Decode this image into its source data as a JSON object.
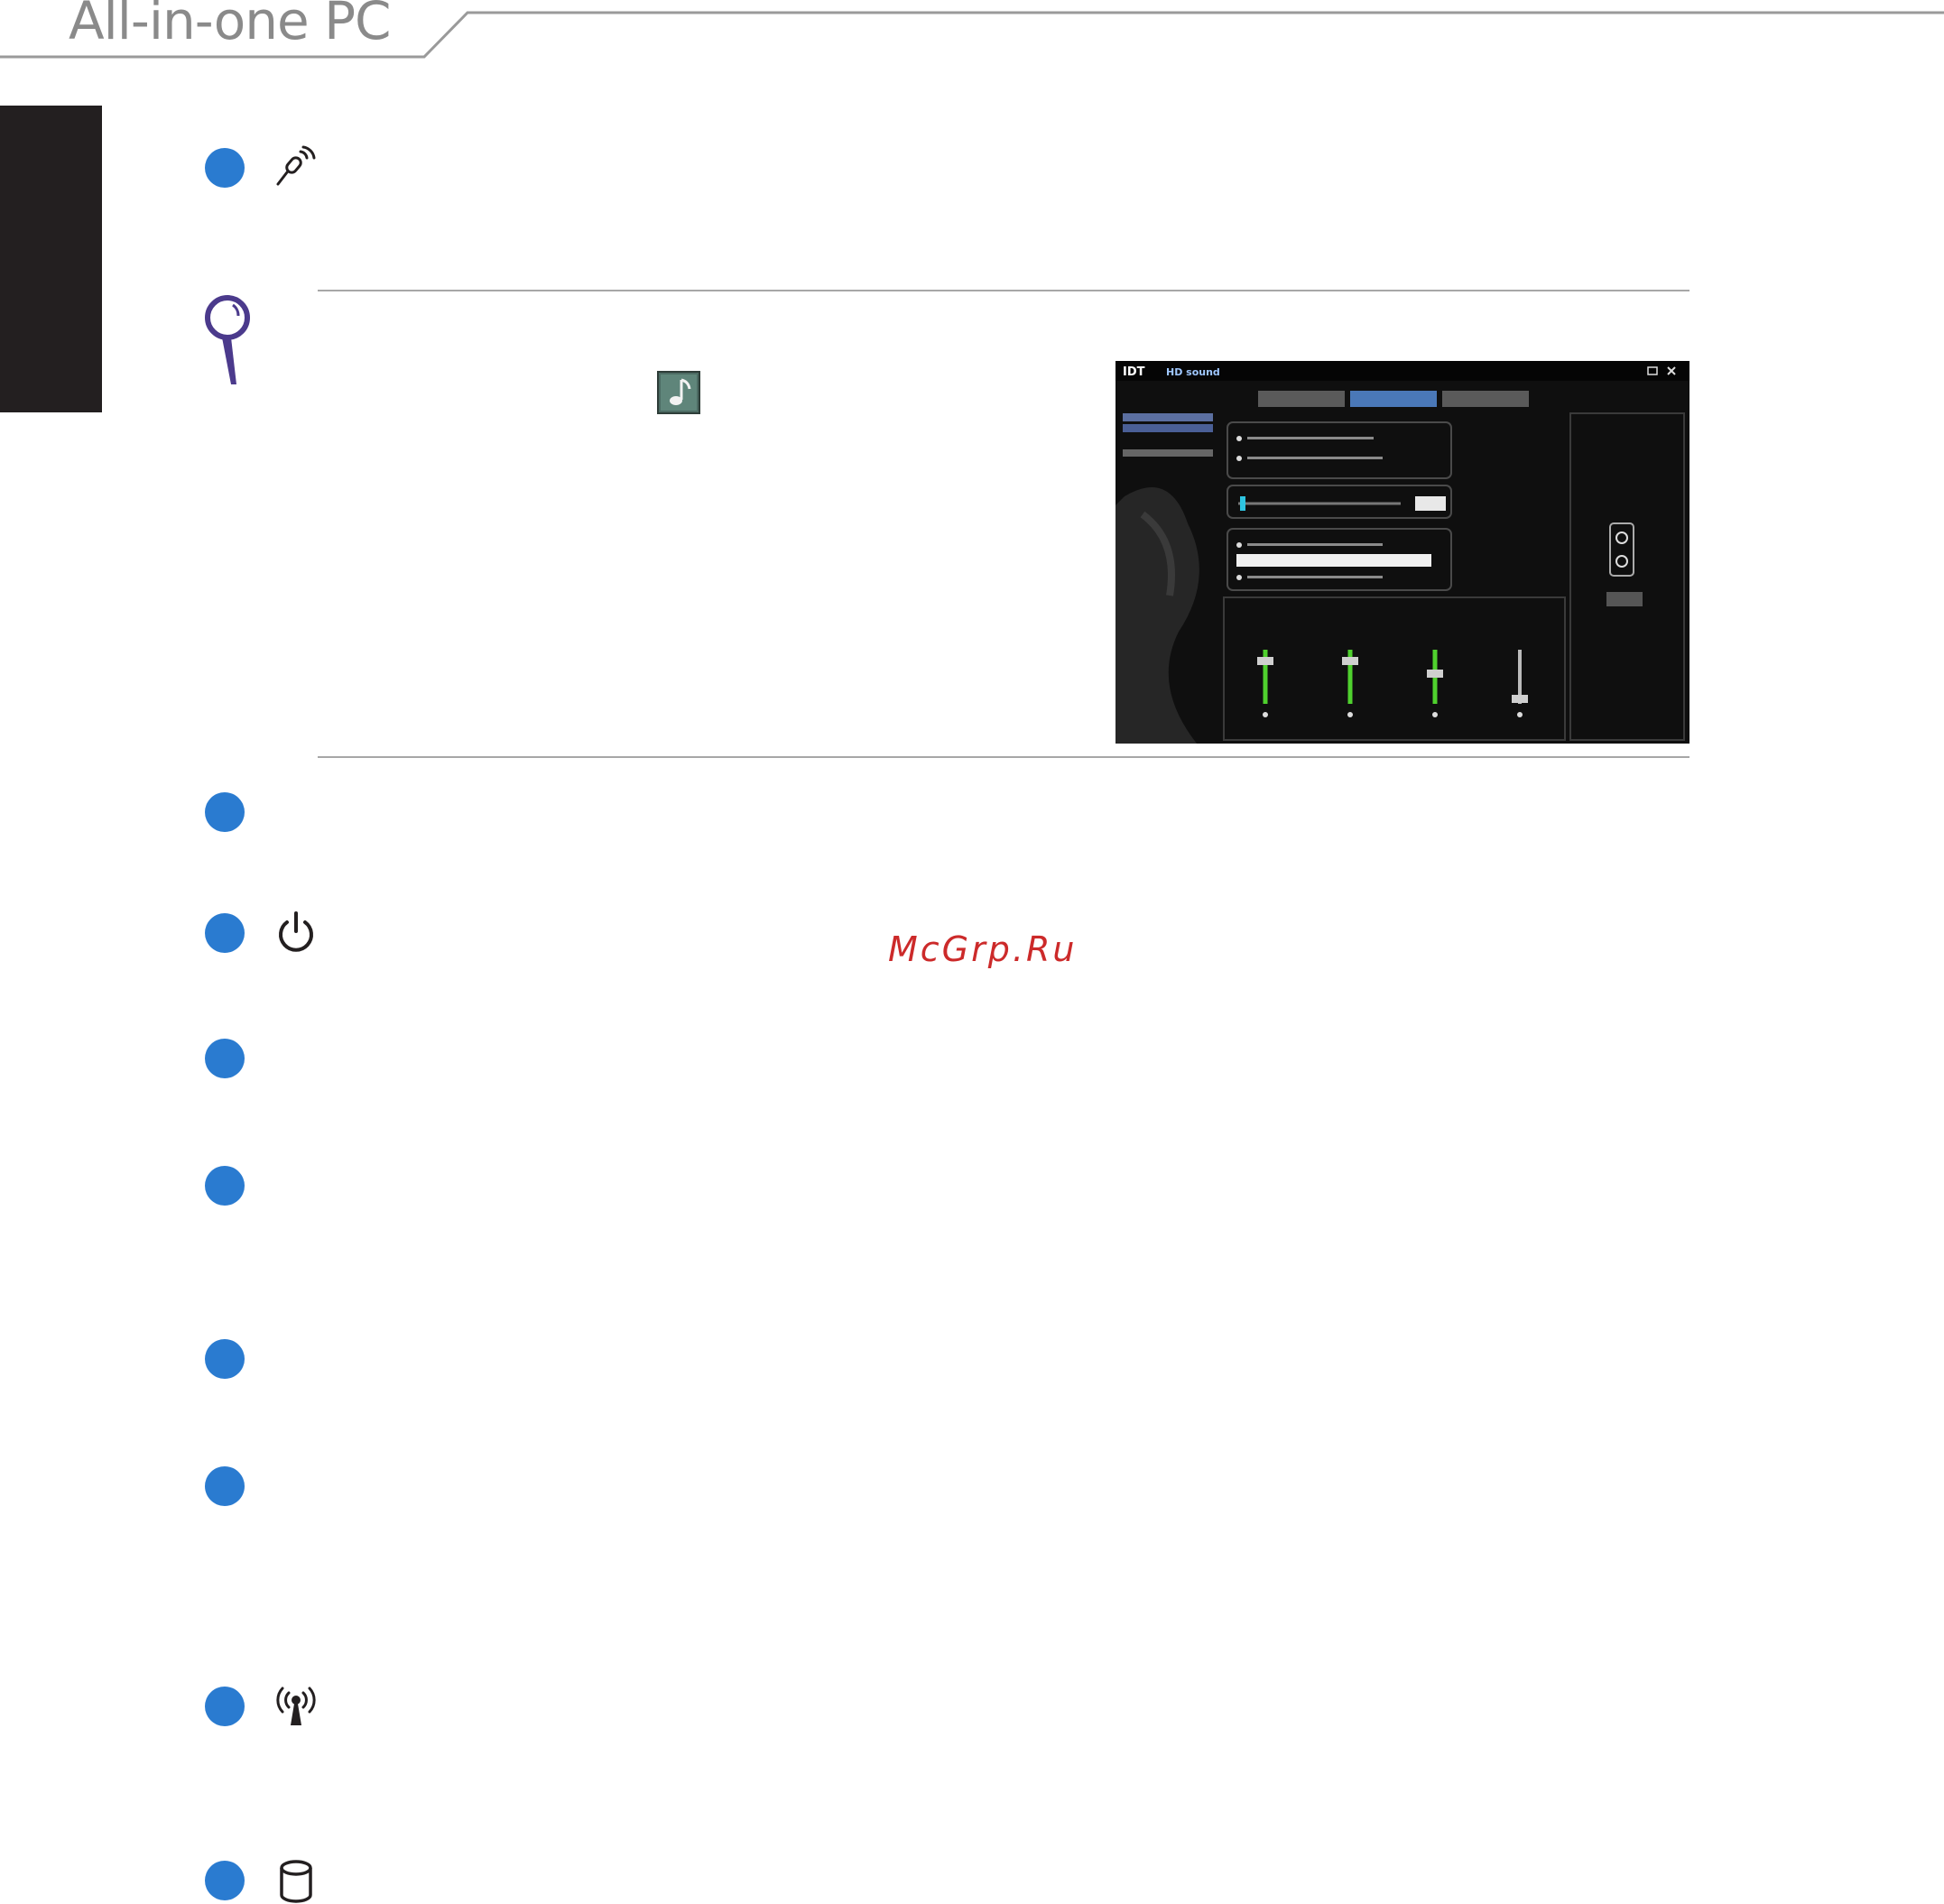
{
  "header": {
    "title": "All-in-one PC"
  },
  "watermark": {
    "text": "McGrp.Ru"
  },
  "items": [
    {
      "icon": "microphone-icon"
    },
    {
      "icon": "none"
    },
    {
      "icon": "power-icon"
    },
    {
      "icon": "none"
    },
    {
      "icon": "none"
    },
    {
      "icon": "none"
    },
    {
      "icon": "none"
    },
    {
      "icon": "wireless-icon"
    },
    {
      "icon": "hdd-icon"
    }
  ],
  "note": {
    "icon": "magnifier-icon",
    "inline_icon": "music-note-icon",
    "screenshot": {
      "app_logo": "IDT HD sound",
      "accent_color": "#4fd12e"
    }
  },
  "colors": {
    "bullet": "#2a7bd0",
    "side_tab": "#231f20",
    "title_gray": "#8a8a8a",
    "watermark": "#cc2a2a"
  }
}
